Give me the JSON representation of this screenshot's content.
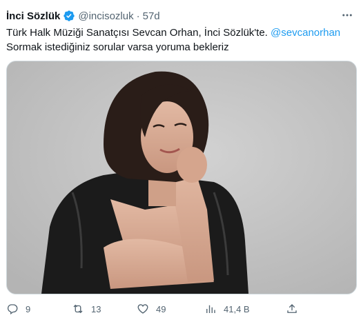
{
  "tweet": {
    "display_name": "İnci Sözlük",
    "handle": "@incisozluk",
    "separator": "·",
    "time": "57d",
    "text_line1": "Türk Halk Müziği Sanatçısı Sevcan Orhan, İnci Sözlük'te.",
    "mention": "@sevcanorhan",
    "text_line2": "Sormak istediğiniz sorular varsa yoruma bekleriz",
    "icons": {
      "verified": "verified-badge-icon",
      "more": "more-options-icon",
      "reply": "reply-icon",
      "retweet": "retweet-icon",
      "like": "like-icon",
      "views": "views-icon",
      "share": "share-icon"
    },
    "colors": {
      "accent": "#1d9bf0",
      "text": "#0f1419",
      "muted": "#536471"
    }
  },
  "actions": {
    "replies": "9",
    "retweets": "13",
    "likes": "49",
    "views": "41,4 B"
  }
}
